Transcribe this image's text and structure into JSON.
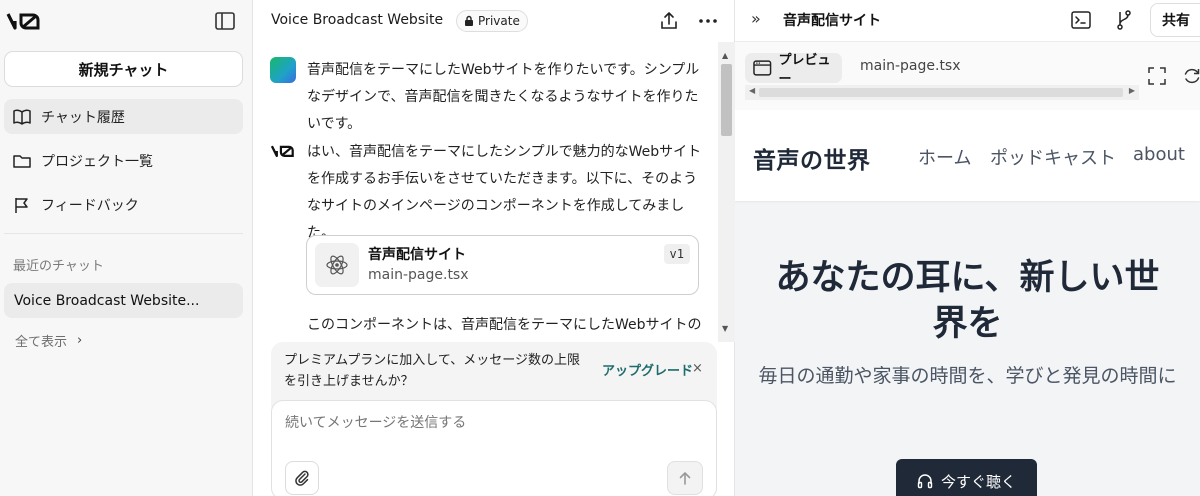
{
  "sidebar": {
    "new_chat": "新規チャット",
    "nav": [
      {
        "label": "チャット履歴",
        "icon": "book-icon"
      },
      {
        "label": "プロジェクト一覧",
        "icon": "folder-icon"
      },
      {
        "label": "フィードバック",
        "icon": "flag-icon"
      }
    ],
    "recent_label": "最近のチャット",
    "recent_chats": [
      "Voice Broadcast Website..."
    ],
    "show_all": "全て表示"
  },
  "chat": {
    "title": "Voice Broadcast Website",
    "visibility": "Private",
    "user_message": "音声配信をテーマにしたWebサイトを作りたいです。シンプルなデザインで、音声配信を聞きたくなるようなサイトを作りたいです。",
    "bot_message": "はい、音声配信をテーマにしたシンプルで魅力的なWebサイトを作成するお手伝いをさせていただきます。以下に、そのようなサイトのメインページのコンポーネントを作成してみました。",
    "file_card": {
      "name": "音声配信サイト",
      "path": "main-page.tsx",
      "version": "v1"
    },
    "bot_message_2": "このコンポーネントは、音声配信をテーマにしたWebサイトのメイン",
    "upgrade": {
      "text": "プレミアムプランに加入して、メッセージ数の上限を引き上げませんか？",
      "link": "アップグレード",
      "close": "×"
    },
    "composer_placeholder": "続いてメッセージを送信する"
  },
  "preview": {
    "title": "音声配信サイト",
    "share": "共有",
    "tab_preview": "プレビュー",
    "tab_code": "main-page.tsx",
    "site": {
      "brand": "音声の世界",
      "links": [
        "ホーム",
        "ポッドキャスト",
        "about"
      ],
      "hero_title": "あなたの耳に、新しい世界を",
      "hero_subtitle": "毎日の通勤や家事の時間を、学びと発見の時間に",
      "cta": "今すぐ聴く"
    }
  }
}
